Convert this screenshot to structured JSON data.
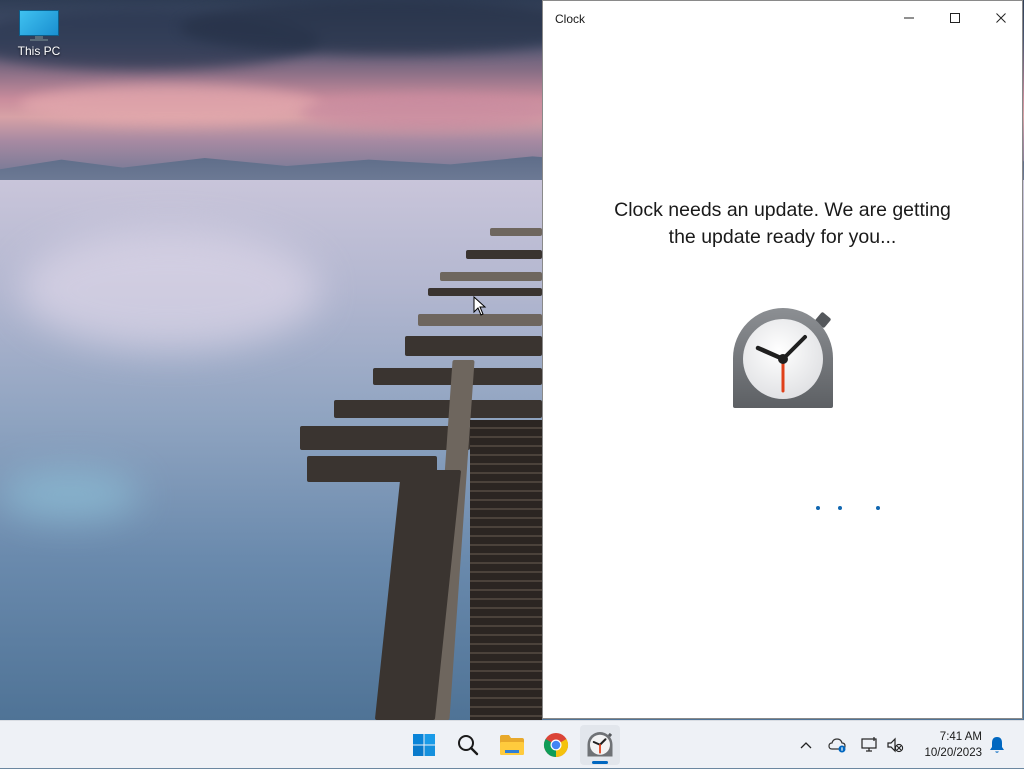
{
  "desktop": {
    "icons": [
      {
        "label": "This PC",
        "icon": "this-pc-icon"
      }
    ]
  },
  "window": {
    "title": "Clock",
    "message_line1": "Clock needs an update. We are getting",
    "message_line2": "the update ready for you...",
    "app_icon": "clock-app-icon",
    "loading_dots": 3,
    "controls": [
      "minimize",
      "maximize",
      "close"
    ]
  },
  "taskbar": {
    "items": [
      {
        "name": "start",
        "icon": "windows-logo-icon"
      },
      {
        "name": "search",
        "icon": "search-icon"
      },
      {
        "name": "file-explorer",
        "icon": "folder-icon"
      },
      {
        "name": "chrome",
        "icon": "chrome-icon"
      },
      {
        "name": "clock",
        "icon": "clock-app-icon",
        "active": true
      }
    ],
    "tray": {
      "icons": [
        "chevron-up-icon",
        "onedrive-icon",
        "network-icon",
        "volume-muted-icon",
        "notification-bell-icon"
      ],
      "time": "7:41 AM",
      "date": "10/20/2023"
    }
  },
  "colors": {
    "accent": "#0067c0",
    "taskbar_bg": "#eef1f6",
    "loading_dot": "#1167b1",
    "clock_hand_red": "#e0401a"
  }
}
